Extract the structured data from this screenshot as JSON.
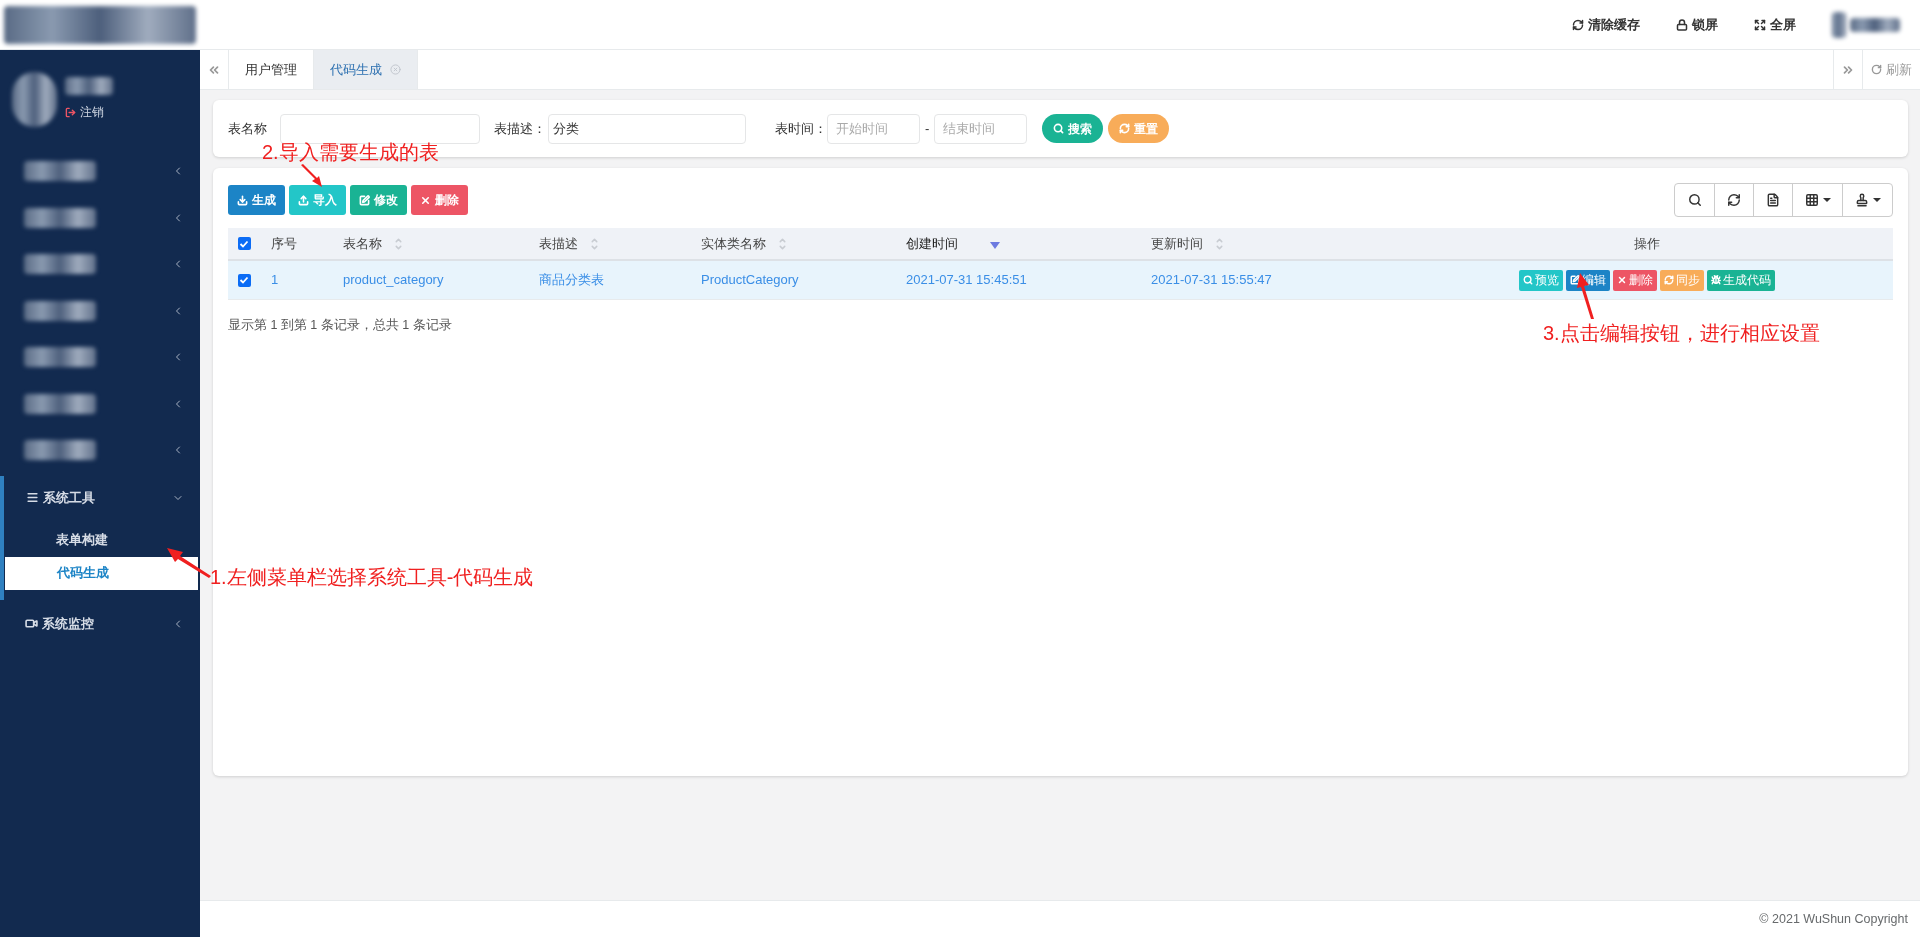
{
  "header": {
    "logo": {
      "kind": "obscured"
    },
    "actions": [
      {
        "label": "清除缓存"
      },
      {
        "label": "锁屏"
      },
      {
        "label": "全屏"
      }
    ],
    "user": {
      "kind": "obscured"
    }
  },
  "sidebar": {
    "user": {
      "kind": "obscured",
      "logout": "注销"
    },
    "menu": [
      {
        "kind": "obscured",
        "expanded": false
      },
      {
        "kind": "obscured",
        "expanded": false
      },
      {
        "kind": "obscured",
        "expanded": false
      },
      {
        "kind": "obscured",
        "expanded": false
      },
      {
        "kind": "obscured",
        "expanded": false
      },
      {
        "kind": "obscured",
        "expanded": false
      },
      {
        "kind": "obscured",
        "expanded": false
      },
      {
        "kind": "group",
        "label": "系统工具",
        "expanded": true,
        "children": [
          {
            "label": "表单构建",
            "selected": false
          },
          {
            "label": "代码生成",
            "selected": true
          }
        ]
      },
      {
        "kind": "group",
        "label": "系统监控",
        "expanded": false
      }
    ]
  },
  "tabs": [
    {
      "label": "用户管理",
      "selected": false,
      "closable": false
    },
    {
      "label": "代码生成",
      "selected": true,
      "closable": true
    }
  ],
  "tab_refresh": "刷新",
  "filters": {
    "fields": [
      {
        "label": "表名称"
      },
      {
        "label": "表描述：",
        "value": "分类"
      }
    ],
    "time": {
      "label": "表时间：",
      "start_placeholder": "开始时间",
      "separator": "-",
      "end_placeholder": "结束时间"
    },
    "buttons": [
      {
        "label": "搜索",
        "kind": "success"
      },
      {
        "label": "重置",
        "kind": "warning"
      }
    ]
  },
  "toolbar": [
    {
      "label": "生成",
      "kind": "primary"
    },
    {
      "label": "导入",
      "kind": "info"
    },
    {
      "label": "修改",
      "kind": "success"
    },
    {
      "label": "删除",
      "kind": "danger"
    }
  ],
  "table": {
    "all_checked": true,
    "columns": [
      {
        "label": "序号",
        "sortable": false,
        "sorted": false
      },
      {
        "label": "表名称",
        "sortable": true,
        "sorted": false
      },
      {
        "label": "表描述",
        "sortable": true,
        "sorted": false
      },
      {
        "label": "实体类名称",
        "sortable": true,
        "sorted": false
      },
      {
        "label": "创建时间",
        "sortable": true,
        "sorted": true
      },
      {
        "label": "更新时间",
        "sortable": true,
        "sorted": false
      },
      {
        "label": "操作",
        "sortable": false,
        "sorted": false
      }
    ],
    "rows": [
      {
        "selected": true,
        "cells": [
          "1",
          "product_category",
          "商品分类表",
          "ProductCategory",
          "2021-07-31 15:45:51",
          "2021-07-31 15:55:47"
        ],
        "actions": [
          {
            "label": "预览",
            "kind": "info"
          },
          {
            "label": "编辑",
            "kind": "primary"
          },
          {
            "label": "删除",
            "kind": "danger"
          },
          {
            "label": "同步",
            "kind": "warning"
          },
          {
            "label": "生成代码",
            "kind": "success"
          }
        ]
      }
    ]
  },
  "pagination": "显示第 1 到第 1 条记录，总共 1 条记录",
  "footer": "© 2021 WuShun Copyright",
  "annotations": [
    {
      "text": "2.导入需要生成的表"
    },
    {
      "text": "3.点击编辑按钮，进行相应设置"
    },
    {
      "text": "1.左侧菜单栏选择系统工具-代码生成"
    }
  ]
}
